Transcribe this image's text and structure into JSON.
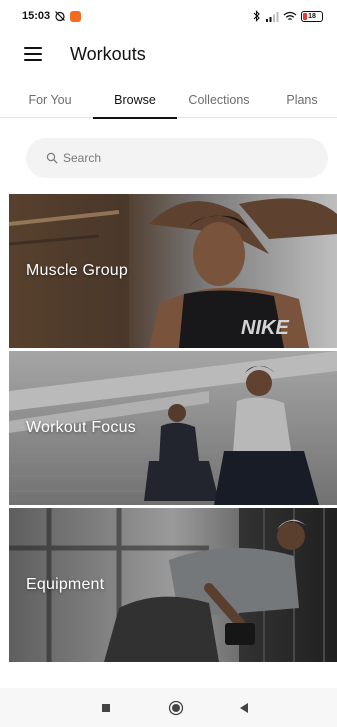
{
  "status_bar": {
    "time": "15:03",
    "battery": "18",
    "colors": {
      "app_badge": "#f46a1f",
      "battery_low": "#e53935"
    },
    "battery_level": 0.18
  },
  "app_bar": {
    "title": "Workouts"
  },
  "tabs": [
    {
      "label": "For You",
      "active": false
    },
    {
      "label": "Browse",
      "active": true
    },
    {
      "label": "Collections",
      "active": false
    },
    {
      "label": "Plans",
      "active": false
    }
  ],
  "search": {
    "placeholder": "Search"
  },
  "cards": [
    {
      "label": "Muscle Group",
      "image_text": "NIKE"
    },
    {
      "label": "Workout Focus"
    },
    {
      "label": "Equipment"
    }
  ],
  "icons": {
    "menu": "hamburger-icon",
    "search": "magnifier-icon",
    "nav_recents": "square-icon",
    "nav_home": "circle-icon",
    "nav_back": "triangle-left-icon"
  }
}
